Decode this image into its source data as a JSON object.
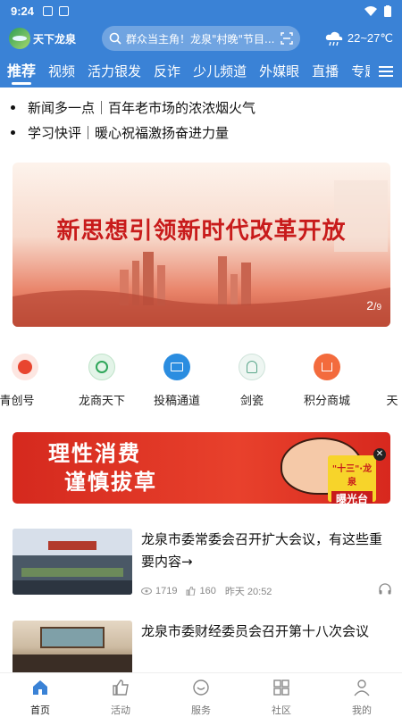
{
  "status_bar": {
    "time": "9:24",
    "icons": [
      "image-icon",
      "app-a-icon",
      "wifi-icon",
      "battery-icon"
    ]
  },
  "header": {
    "logo_text": "天下龙泉",
    "search_text": "群众当主角！龙泉\"村晚\"节目...",
    "weather": "22~27℃"
  },
  "tabs": [
    "推荐",
    "视频",
    "活力银发",
    "反诈",
    "少儿频道",
    "外媒眼",
    "直播",
    "专题"
  ],
  "headlines": [
    "新闻多一点｜百年老市场的浓浓烟火气",
    "学习快评｜暖心祝福激扬奋进力量"
  ],
  "banner": {
    "title": "新思想引领新时代改革开放",
    "page_current": "2",
    "page_total": "9"
  },
  "quick_links": [
    {
      "label": "青创号",
      "icon": "qingchuang-icon",
      "color": "#e8452f"
    },
    {
      "label": "龙商天下",
      "icon": "longshang-icon",
      "color": "#2fa65a"
    },
    {
      "label": "投稿通道",
      "icon": "mail-icon",
      "color": "#2b8de0"
    },
    {
      "label": "剑瓷",
      "icon": "jianci-icon",
      "color": "#5aa68a"
    },
    {
      "label": "积分商城",
      "icon": "cart-icon",
      "color": "#f36b3d"
    },
    {
      "label": "天",
      "icon": "more-icon",
      "color": "#999999"
    }
  ],
  "ad": {
    "line1": "理性消费",
    "line2": "谨慎拔草",
    "badge_top": "\"十三\"·龙泉",
    "badge_bottom": "曝光台"
  },
  "articles": [
    {
      "title": "龙泉市委常委会召开扩大会议，有这些重要内容→",
      "views": "1719",
      "likes": "160",
      "time": "昨天 20:52"
    },
    {
      "title": "龙泉市委财经委员会召开第十八次会议"
    }
  ],
  "bottom_nav": [
    {
      "label": "首页",
      "icon": "home-icon"
    },
    {
      "label": "活动",
      "icon": "thumb-icon"
    },
    {
      "label": "服务",
      "icon": "service-icon"
    },
    {
      "label": "社区",
      "icon": "grid-icon"
    },
    {
      "label": "我的",
      "icon": "user-icon"
    }
  ],
  "colors": {
    "brand": "#3a82d6",
    "banner_red": "#c81b1b"
  }
}
